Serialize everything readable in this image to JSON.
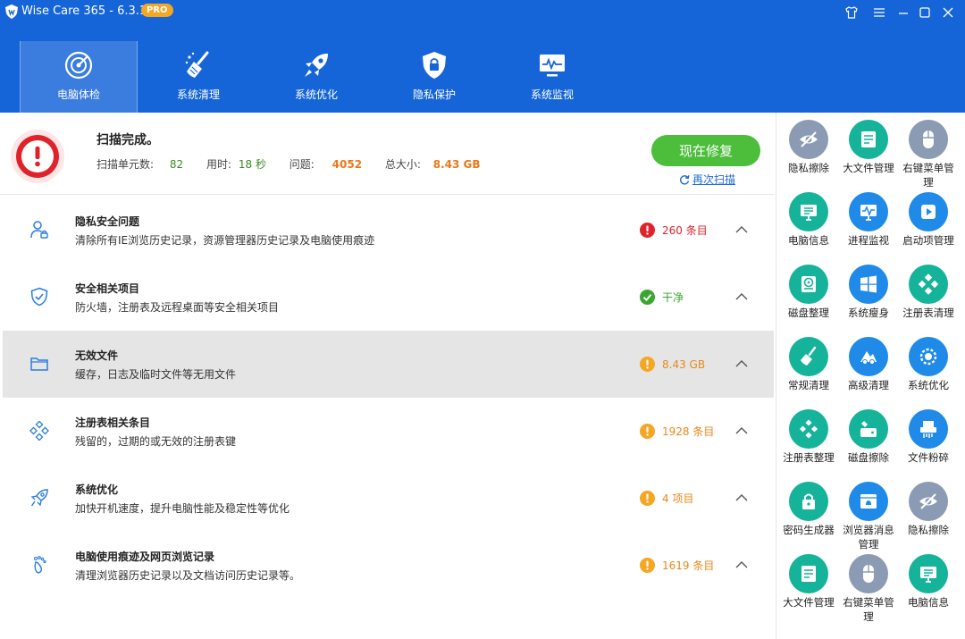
{
  "app": {
    "title": "Wise Care 365 - 6.3.1",
    "badge": "PRO"
  },
  "window_controls": [
    "shirt-icon",
    "menu-icon",
    "minimize-icon",
    "maximize-icon",
    "close-icon"
  ],
  "nav": [
    {
      "label": "电脑体检",
      "icon": "radar-icon",
      "active": true
    },
    {
      "label": "系统清理",
      "icon": "broom-icon",
      "active": false
    },
    {
      "label": "系统优化",
      "icon": "rocket-icon",
      "active": false
    },
    {
      "label": "隐私保护",
      "icon": "shield-lock-icon",
      "active": false
    },
    {
      "label": "系统监视",
      "icon": "monitor-icon",
      "active": false
    }
  ],
  "summary": {
    "title": "扫描完成。",
    "scanned_label": "扫描单元数:",
    "scanned_value": "82",
    "time_label": "用时:",
    "time_value": "18 秒",
    "issues_label": "问题:",
    "issues_value": "4052",
    "size_label": "总大小:",
    "size_value": "8.43 GB",
    "fix_button": "现在修复",
    "rescan_link": "再次扫描"
  },
  "results": [
    {
      "title": "隐私安全问题",
      "desc": "清除所有IE浏览历史记录，资源管理器历史记录及电脑使用痕迹",
      "status": "260 条目",
      "level": "error",
      "icon": "user-lock-icon"
    },
    {
      "title": "安全相关项目",
      "desc": "防火墙，注册表及远程桌面等安全相关项目",
      "status": "干净",
      "level": "ok",
      "icon": "shield-check-icon"
    },
    {
      "title": "无效文件",
      "desc": "缓存，日志及临时文件等无用文件",
      "status": "8.43 GB",
      "level": "warn",
      "icon": "folder-icon"
    },
    {
      "title": "注册表相关条目",
      "desc": "残留的，过期的或无效的注册表键",
      "status": "1928 条目",
      "level": "warn",
      "icon": "registry-icon"
    },
    {
      "title": "系统优化",
      "desc": "加快开机速度，提升电脑性能及稳定性等优化",
      "status": "4 项目",
      "level": "warn",
      "icon": "rocket-outline-icon"
    },
    {
      "title": "电脑使用痕迹及网页浏览记录",
      "desc": "清理浏览器历史记录以及文档访问历史记录等。",
      "status": "1619 条目",
      "level": "warn",
      "icon": "footprint-icon"
    }
  ],
  "tools": [
    {
      "label": "隐私擦除",
      "icon": "eye-off-icon",
      "color": "gray"
    },
    {
      "label": "大文件管理",
      "icon": "large-file-icon",
      "color": "teal"
    },
    {
      "label": "右键菜单管理",
      "icon": "mouse-icon",
      "color": "gray"
    },
    {
      "label": "电脑信息",
      "icon": "pc-info-icon",
      "color": "teal"
    },
    {
      "label": "进程监视",
      "icon": "process-monitor-icon",
      "color": "blue"
    },
    {
      "label": "启动项管理",
      "icon": "startup-icon",
      "color": "blue"
    },
    {
      "label": "磁盘整理",
      "icon": "disk-defrag-icon",
      "color": "teal"
    },
    {
      "label": "系统瘦身",
      "icon": "windows-icon",
      "color": "blue"
    },
    {
      "label": "注册表清理",
      "icon": "registry-clean-icon",
      "color": "teal"
    },
    {
      "label": "常规清理",
      "icon": "broom-icon",
      "color": "teal"
    },
    {
      "label": "高级清理",
      "icon": "advanced-clean-icon",
      "color": "blue"
    },
    {
      "label": "系统优化",
      "icon": "optimize-icon",
      "color": "blue"
    },
    {
      "label": "注册表整理",
      "icon": "registry-defrag-icon",
      "color": "teal"
    },
    {
      "label": "磁盘擦除",
      "icon": "disk-wipe-icon",
      "color": "teal"
    },
    {
      "label": "文件粉碎",
      "icon": "shredder-icon",
      "color": "blue"
    },
    {
      "label": "密码生成器",
      "icon": "password-lock-icon",
      "color": "teal"
    },
    {
      "label": "浏览器消息管理",
      "icon": "browser-bell-icon",
      "color": "blue"
    },
    {
      "label": "隐私擦除",
      "icon": "eye-off-icon",
      "color": "gray"
    },
    {
      "label": "大文件管理",
      "icon": "large-file-icon",
      "color": "teal"
    },
    {
      "label": "右键菜单管理",
      "icon": "mouse-icon",
      "color": "gray"
    },
    {
      "label": "电脑信息",
      "icon": "pc-info-icon",
      "color": "teal"
    }
  ],
  "colors": {
    "header": "#1565d8",
    "accent_green": "#4cbe3b",
    "error": "#e0222b",
    "warning": "#f5a623",
    "ok": "#3aa631"
  }
}
